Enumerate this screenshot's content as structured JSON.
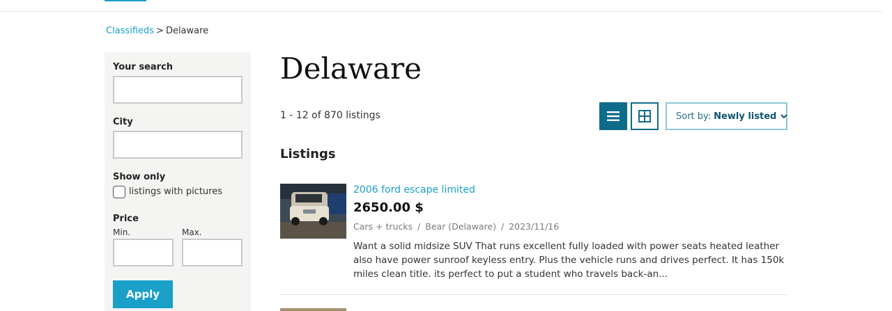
{
  "breadcrumb": {
    "root": "Classifieds",
    "separator": ">",
    "current": "Delaware"
  },
  "sidebar": {
    "search_label": "Your search",
    "search_value": "",
    "city_label": "City",
    "city_value": "",
    "show_only_label": "Show only",
    "pictures_label": "listings with pictures",
    "pictures_checked": false,
    "price_label": "Price",
    "min_label": "Min.",
    "max_label": "Max.",
    "min_value": "",
    "max_value": "",
    "apply_label": "Apply"
  },
  "page": {
    "title": "Delaware",
    "count_text": "1 - 12 of 870 listings",
    "section_title": "Listings"
  },
  "toolbar": {
    "list_view_icon": "list-icon",
    "grid_view_icon": "grid-icon",
    "sort_prefix": "Sort by:",
    "sort_value": "Newly listed"
  },
  "listings": [
    {
      "title": "2006 ford escape limited",
      "price": "2650.00 $",
      "category": "Cars + trucks",
      "location": "Bear (Delaware)",
      "date": "2023/11/16",
      "description": "Want a solid midsize SUV That runs excellent fully loaded with power seats heated leather also have power sunroof keyless entry. Plus the vehicle runs and drives perfect. It has 150k miles clean title. its perfect to put a student who travels back-an..."
    }
  ],
  "colors": {
    "accent": "#1a9fc9",
    "dark_accent": "#0f6b8a",
    "sidebar_bg": "#f4f4f2"
  }
}
